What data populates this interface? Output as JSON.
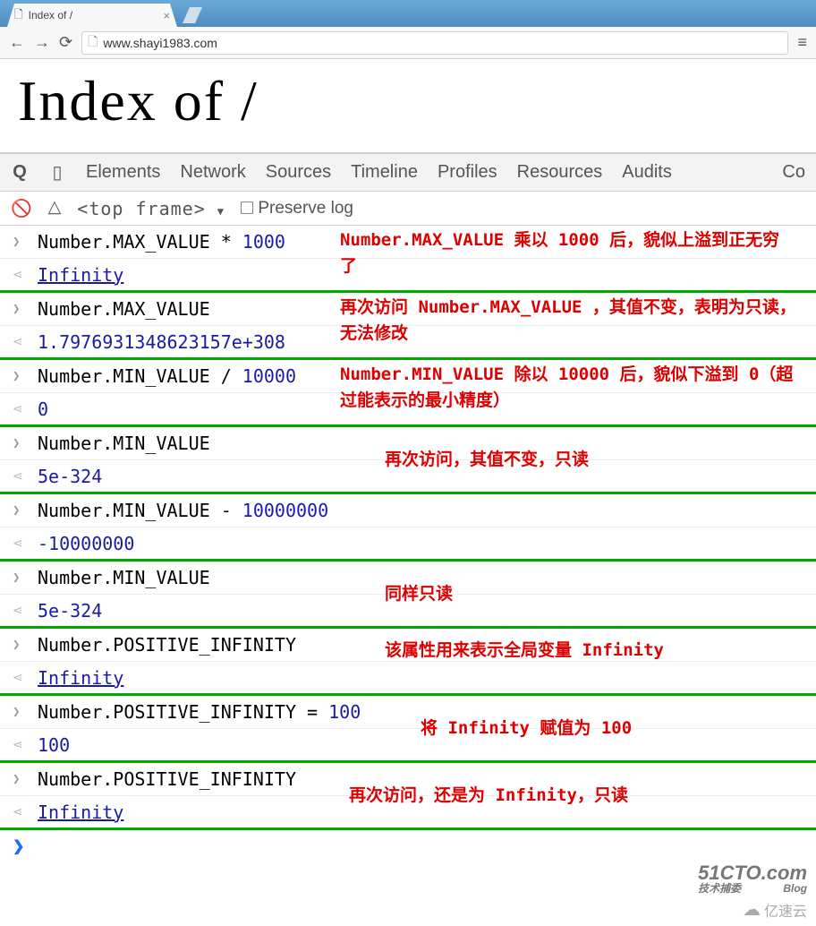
{
  "browser": {
    "tab_title": "Index of /",
    "url": "www.shayi1983.com"
  },
  "page": {
    "heading": "Index of /"
  },
  "devtools": {
    "tabs": [
      "Elements",
      "Network",
      "Sources",
      "Timeline",
      "Profiles",
      "Resources",
      "Audits",
      "Co"
    ],
    "subbar": {
      "frame": "<top frame>",
      "preserve": "Preserve log"
    }
  },
  "console_entries": [
    {
      "input_parts": [
        "Number.MAX_VALUE * ",
        {
          "num": "1000"
        }
      ],
      "output_parts": [
        {
          "num_u": "Infinity"
        }
      ],
      "annot": "Number.MAX_VALUE 乘以 1000 后，貌似上溢到正无穷了",
      "annot_style": "left:380px; top:2px; width:510px;"
    },
    {
      "input_parts": [
        "Number.MAX_VALUE"
      ],
      "output_parts": [
        {
          "num": "1.7976931348623157e+308"
        }
      ],
      "annot": "再次访问 Number.MAX_VALUE ，其值不变，表明为只读，无法修改",
      "annot_style": "left:380px; top:2px; width:520px;"
    },
    {
      "input_parts": [
        "Number.MIN_VALUE / ",
        {
          "num": "10000"
        }
      ],
      "output_parts": [
        {
          "num": "0"
        }
      ],
      "annot": "Number.MIN_VALUE 除以 10000 后，貌似下溢到 0（超过能表示的最小精度）",
      "annot_style": "left:380px; top:2px; width:520px;"
    },
    {
      "input_parts": [
        "Number.MIN_VALUE"
      ],
      "output_parts": [
        {
          "num": "5e-324"
        }
      ],
      "annot": "再次访问，其值不变，只读",
      "annot_style": "left:430px; top:22px;"
    },
    {
      "input_parts": [
        "Number.MIN_VALUE - ",
        {
          "num": "10000000"
        }
      ],
      "output_parts": [
        {
          "num": "-10000000"
        }
      ],
      "annot": "",
      "annot_style": ""
    },
    {
      "input_parts": [
        "Number.MIN_VALUE"
      ],
      "output_parts": [
        {
          "num": "5e-324"
        }
      ],
      "annot": "同样只读",
      "annot_style": "left:430px; top:22px;"
    },
    {
      "input_parts": [
        "Number.POSITIVE_INFINITY"
      ],
      "output_parts": [
        {
          "num_u": "Infinity"
        }
      ],
      "annot": "该属性用来表示全局变量 Infinity",
      "annot_style": "left:430px; top:10px;"
    },
    {
      "input_parts": [
        "Number.POSITIVE_INFINITY = ",
        {
          "num": "100"
        }
      ],
      "output_parts": [
        {
          "num": "100"
        }
      ],
      "annot": "将 Infinity 赋值为 100",
      "annot_style": "left:470px; top:22px;"
    },
    {
      "input_parts": [
        "Number.POSITIVE_INFINITY"
      ],
      "output_parts": [
        {
          "num_u": "Infinity"
        }
      ],
      "annot": "再次访问，还是为 Infinity，只读",
      "annot_style": "left:390px; top:22px;"
    }
  ],
  "watermark1": {
    "top": "51CTO.com",
    "left": "技术捕委",
    "right": "Blog"
  },
  "watermark2": "亿速云"
}
